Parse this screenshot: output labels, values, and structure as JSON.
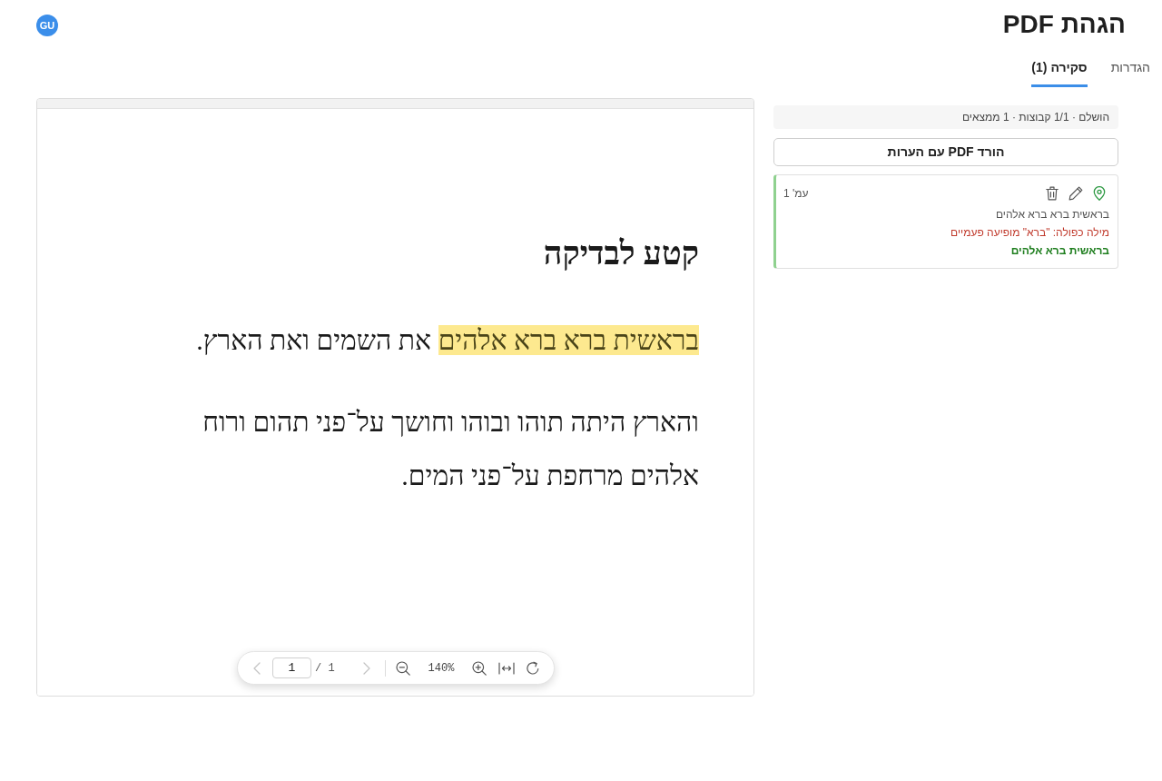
{
  "header": {
    "title": "הגהת PDF",
    "avatar": "GU"
  },
  "tabs": [
    {
      "label": "הגדרות",
      "selected": false
    },
    {
      "label": "סקירה (1)",
      "selected": true
    }
  ],
  "review_panel": {
    "summary": "הושלם · 1/1 קבוצות · 1 ממצאים",
    "download_button": "הורד PDF עם הערות",
    "findings": [
      {
        "page": "עמ' 1",
        "original": "בראשית ברא ברא אלהים",
        "issue": "מילה כפולה: \"ברא\" מופיעה פעמיים",
        "suggestion": "בראשית ברא אלהים"
      }
    ]
  },
  "viewer": {
    "document": {
      "heading": "קטע לבדיקה",
      "paragraphs": [
        {
          "lines": [
            {
              "segments": [
                {
                  "text": "בראשית ברא ברא אלהים",
                  "highlighted": true
                },
                {
                  "text": " את השמים ואת הארץ.",
                  "highlighted": false
                }
              ]
            }
          ]
        },
        {
          "lines": [
            {
              "segments": [
                {
                  "text": "והארץ היתה תוהו ובוהו וחושך על־פני תהום ורוח",
                  "highlighted": false
                }
              ]
            },
            {
              "segments": [
                {
                  "text": "אלהים מרחפת על־פני המים.",
                  "highlighted": false
                }
              ]
            }
          ]
        }
      ]
    },
    "toolbar": {
      "previous_page": {
        "disabled": true
      },
      "page": "1",
      "page_count": "/ 1",
      "next_page": {
        "disabled": true
      },
      "zoom": "140%"
    }
  }
}
